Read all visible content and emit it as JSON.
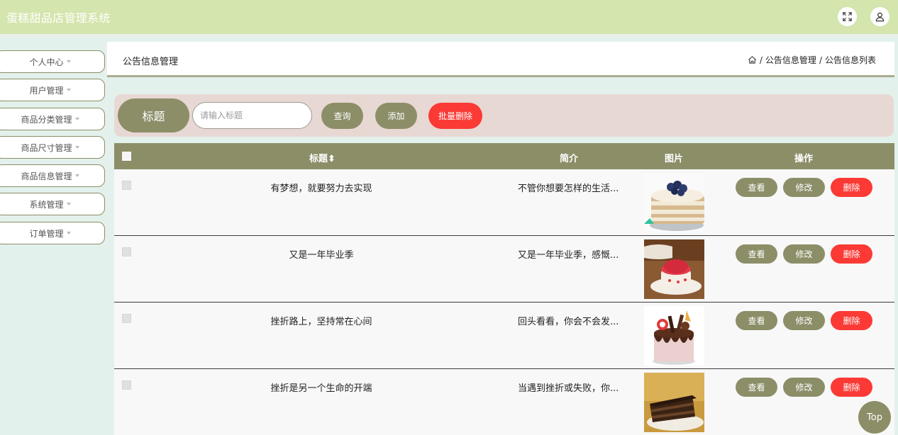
{
  "app": {
    "title": "蛋糕甜品店管理系统"
  },
  "header_icons": [
    "fullscreen-icon",
    "user-icon"
  ],
  "sidebar": {
    "items": [
      {
        "label": "个人中心"
      },
      {
        "label": "用户管理"
      },
      {
        "label": "商品分类管理"
      },
      {
        "label": "商品尺寸管理"
      },
      {
        "label": "商品信息管理"
      },
      {
        "label": "系统管理"
      },
      {
        "label": "订单管理"
      }
    ]
  },
  "page": {
    "title": "公告信息管理",
    "breadcrumb": [
      "公告信息管理",
      "公告信息列表"
    ],
    "breadcrumb_sep": "/"
  },
  "search": {
    "label": "标题",
    "placeholder": "请输入标题",
    "query_label": "查询",
    "add_label": "添加",
    "batch_delete_label": "批量删除"
  },
  "table": {
    "headers": {
      "title": "标题",
      "intro": "简介",
      "image": "图片",
      "actions": "操作"
    },
    "sort_icon": "⬍",
    "action_labels": {
      "view": "查看",
      "edit": "修改",
      "delete": "删除"
    },
    "rows": [
      {
        "title": "有梦想，就要努力去实现",
        "intro": "不管你想要怎样的生活...",
        "image": "blueberry-layer-cake"
      },
      {
        "title": "又是一年毕业季",
        "intro": "又是一年毕业季，感慨...",
        "image": "strawberry-dessert"
      },
      {
        "title": "挫折路上，坚持常在心间",
        "intro": "回头看看，你会不会发...",
        "image": "chocolate-drip-cake"
      },
      {
        "title": "挫折是另一个生命的开端",
        "intro": "当遇到挫折或失败，你...",
        "image": "chocolate-cake-slice"
      }
    ]
  },
  "scroll_top": {
    "label": "Top"
  },
  "colors": {
    "topbar": "#d4e5ad",
    "accent": "#8c8e68",
    "danger": "#fb3a35",
    "search_panel": "#e8d8d4",
    "background": "#e3f1ec"
  }
}
